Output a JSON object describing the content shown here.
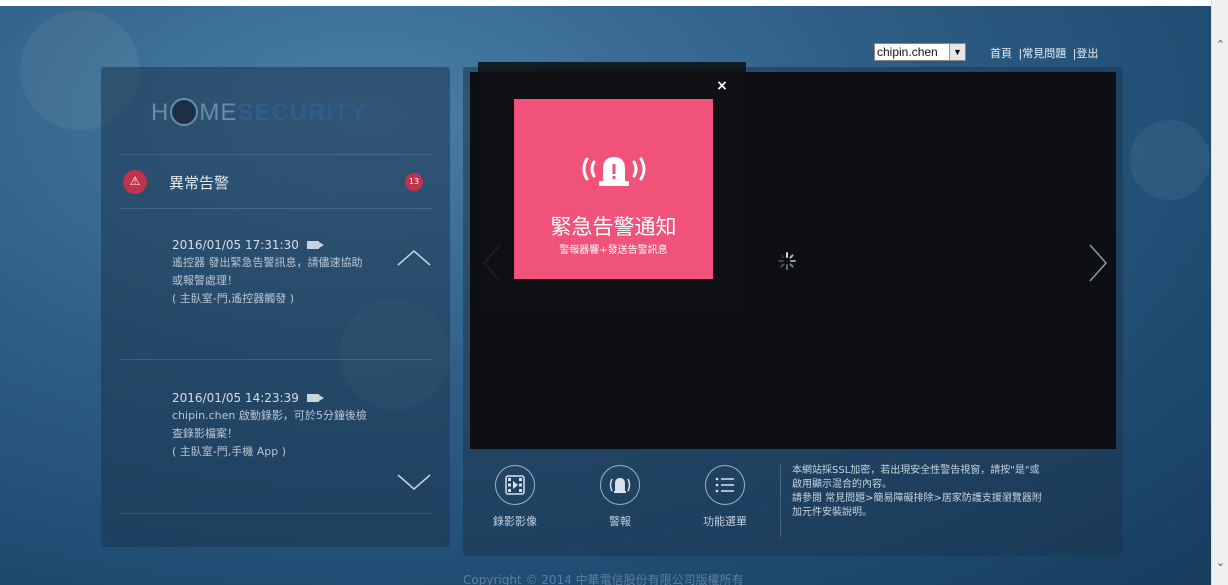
{
  "header": {
    "user_select_value": "chipin.chen",
    "links": [
      "首頁",
      "|常見問題",
      "|登出"
    ]
  },
  "logo": {
    "part1": "H",
    "part2": "ME",
    "part3": "SECURITY"
  },
  "alerts": {
    "title": "異常告警",
    "count": "13",
    "items": [
      {
        "time": "2016/01/05 17:31:30",
        "line1": "遙控器 發出緊急告警訊息，請儘速協助",
        "line2": "或報警處理！",
        "line3": "( 主臥室-門,遙控器觸發 )"
      },
      {
        "time": "2016/01/05 14:23:39",
        "line1": "chipin.chen 啟動錄影，可於5分鐘後檢",
        "line2": "查錄影檔案！",
        "line3": "( 主臥室-門,手機 App )"
      }
    ]
  },
  "modal": {
    "close": "×",
    "title": "緊急告警通知",
    "subtitle": "警報器響+發送告警訊息"
  },
  "functions": [
    {
      "label": "錄影影像",
      "icon": "film-icon"
    },
    {
      "label": "警報",
      "icon": "alarm-icon"
    },
    {
      "label": "功能選單",
      "icon": "menu-icon"
    }
  ],
  "info": {
    "line1": "本網站採SSL加密，若出現安全性警告視窗，請按\"是\"或",
    "line2": "啟用顯示混合的內容。",
    "line3": "請參閱 常見問題>簡易障礙排除>居家防護支援瀏覽器附",
    "line4": "加元件安裝說明。"
  },
  "copyright": "Copyright © 2014 中華電信股份有限公司版權所有",
  "colors": {
    "accent_pink": "#f0527a",
    "alert_red": "#c0334e"
  }
}
